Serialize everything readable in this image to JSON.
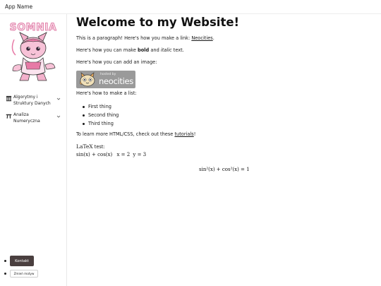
{
  "app": {
    "name": "App Name"
  },
  "sidebar": {
    "logo_text": "SOMNIA",
    "items": [
      {
        "label": "Algorytmy i Struktury Danych"
      },
      {
        "label": "Analiza Numeryczna"
      }
    ],
    "buttons": {
      "kontakt": "Kontakt",
      "theme": "Zmień motyw"
    }
  },
  "content": {
    "title": "Welcome to my Website!",
    "p1_before": "This is a paragraph! Here's how you make a link: ",
    "p1_link": "Neocities",
    "p1_after": ".",
    "p2_before": "Here's how you can make ",
    "p2_bold": "bold",
    "p2_mid": " and ",
    "p2_italic": "italic",
    "p2_after": " text.",
    "p3": "Here's how you can add an image:",
    "image_top": "hosted by",
    "image_main": "neocities",
    "p4": "Here's how to make a list:",
    "list": [
      "First thing",
      "Second thing",
      "Third thing"
    ],
    "p5_before": "To learn more HTML/CSS, check out these ",
    "p5_link": "tutorials",
    "p5_after": "!",
    "latex_label": "LaTeX",
    "latex_after": " test:",
    "inline_eq_1": "sin(x) + cos(x)",
    "inline_eq_2": "x = 2",
    "inline_eq_3": "y = 3",
    "display_eq": "sin²(x) + cos²(x) = 1"
  },
  "colors": {
    "kontakt_button_bg": "#4a3f3f",
    "logo_pink": "#f2a7c6",
    "image_bg": "#9a9a9a"
  }
}
